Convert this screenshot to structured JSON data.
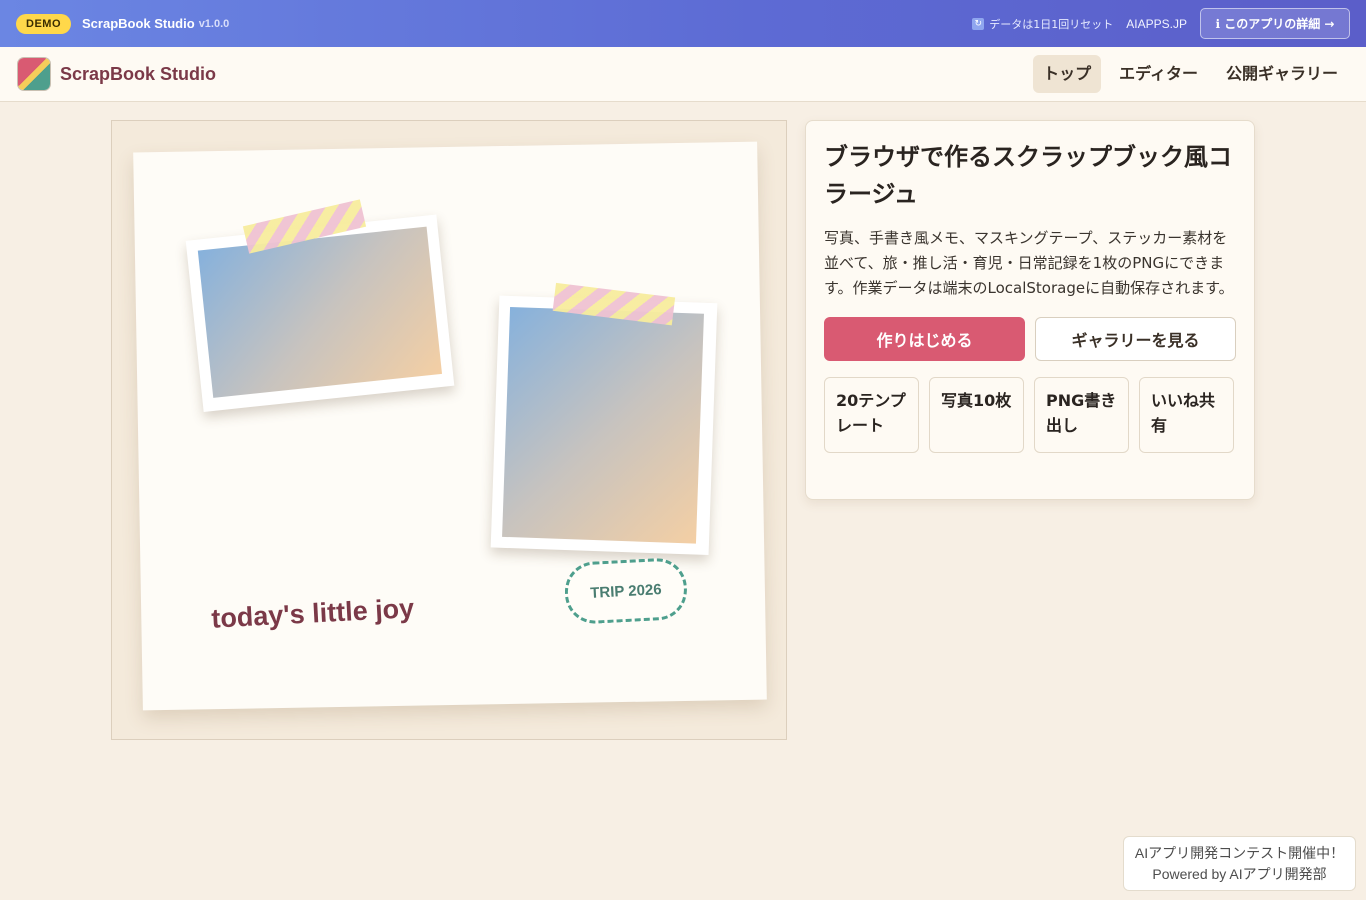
{
  "demo_bar": {
    "badge": "DEMO",
    "title": "ScrapBook Studio",
    "version": "v1.0.0",
    "reset_note": "データは1日1回リセット",
    "reset_icon": "refresh-icon",
    "site": "AIAPPS.JP",
    "detail_button": "ℹ このアプリの詳細 →"
  },
  "header": {
    "brand": "ScrapBook Studio",
    "nav": [
      {
        "label": "トップ",
        "active": true
      },
      {
        "label": "エディター",
        "active": false
      },
      {
        "label": "公開ギャラリー",
        "active": false
      }
    ]
  },
  "canvas": {
    "handwriting": "today's little joy",
    "stamp": "TRIP 2026"
  },
  "info": {
    "title": "ブラウザで作るスクラップブック風コラージュ",
    "description": "写真、手書き風メモ、マスキングテープ、ステッカー素材を並べて、旅・推し活・育児・日常記録を1枚のPNGにできます。作業データは端末のLocalStorageに自動保存されます。",
    "primary_button": "作りはじめる",
    "secondary_button": "ギャラリーを見る",
    "features": [
      "20テンプレート",
      "写真10枚",
      "PNG書き出し",
      "いいね共有"
    ]
  },
  "contest": {
    "line1": "AIアプリ開発コンテスト開催中！",
    "line2": "Powered by AIアプリ開発部"
  },
  "colors": {
    "accent": "#d95a72",
    "brand_text": "#7b3948",
    "teal": "#4e9f8d",
    "demo_gradient_start": "#6b86e3",
    "demo_gradient_end": "#5b5ec9"
  }
}
